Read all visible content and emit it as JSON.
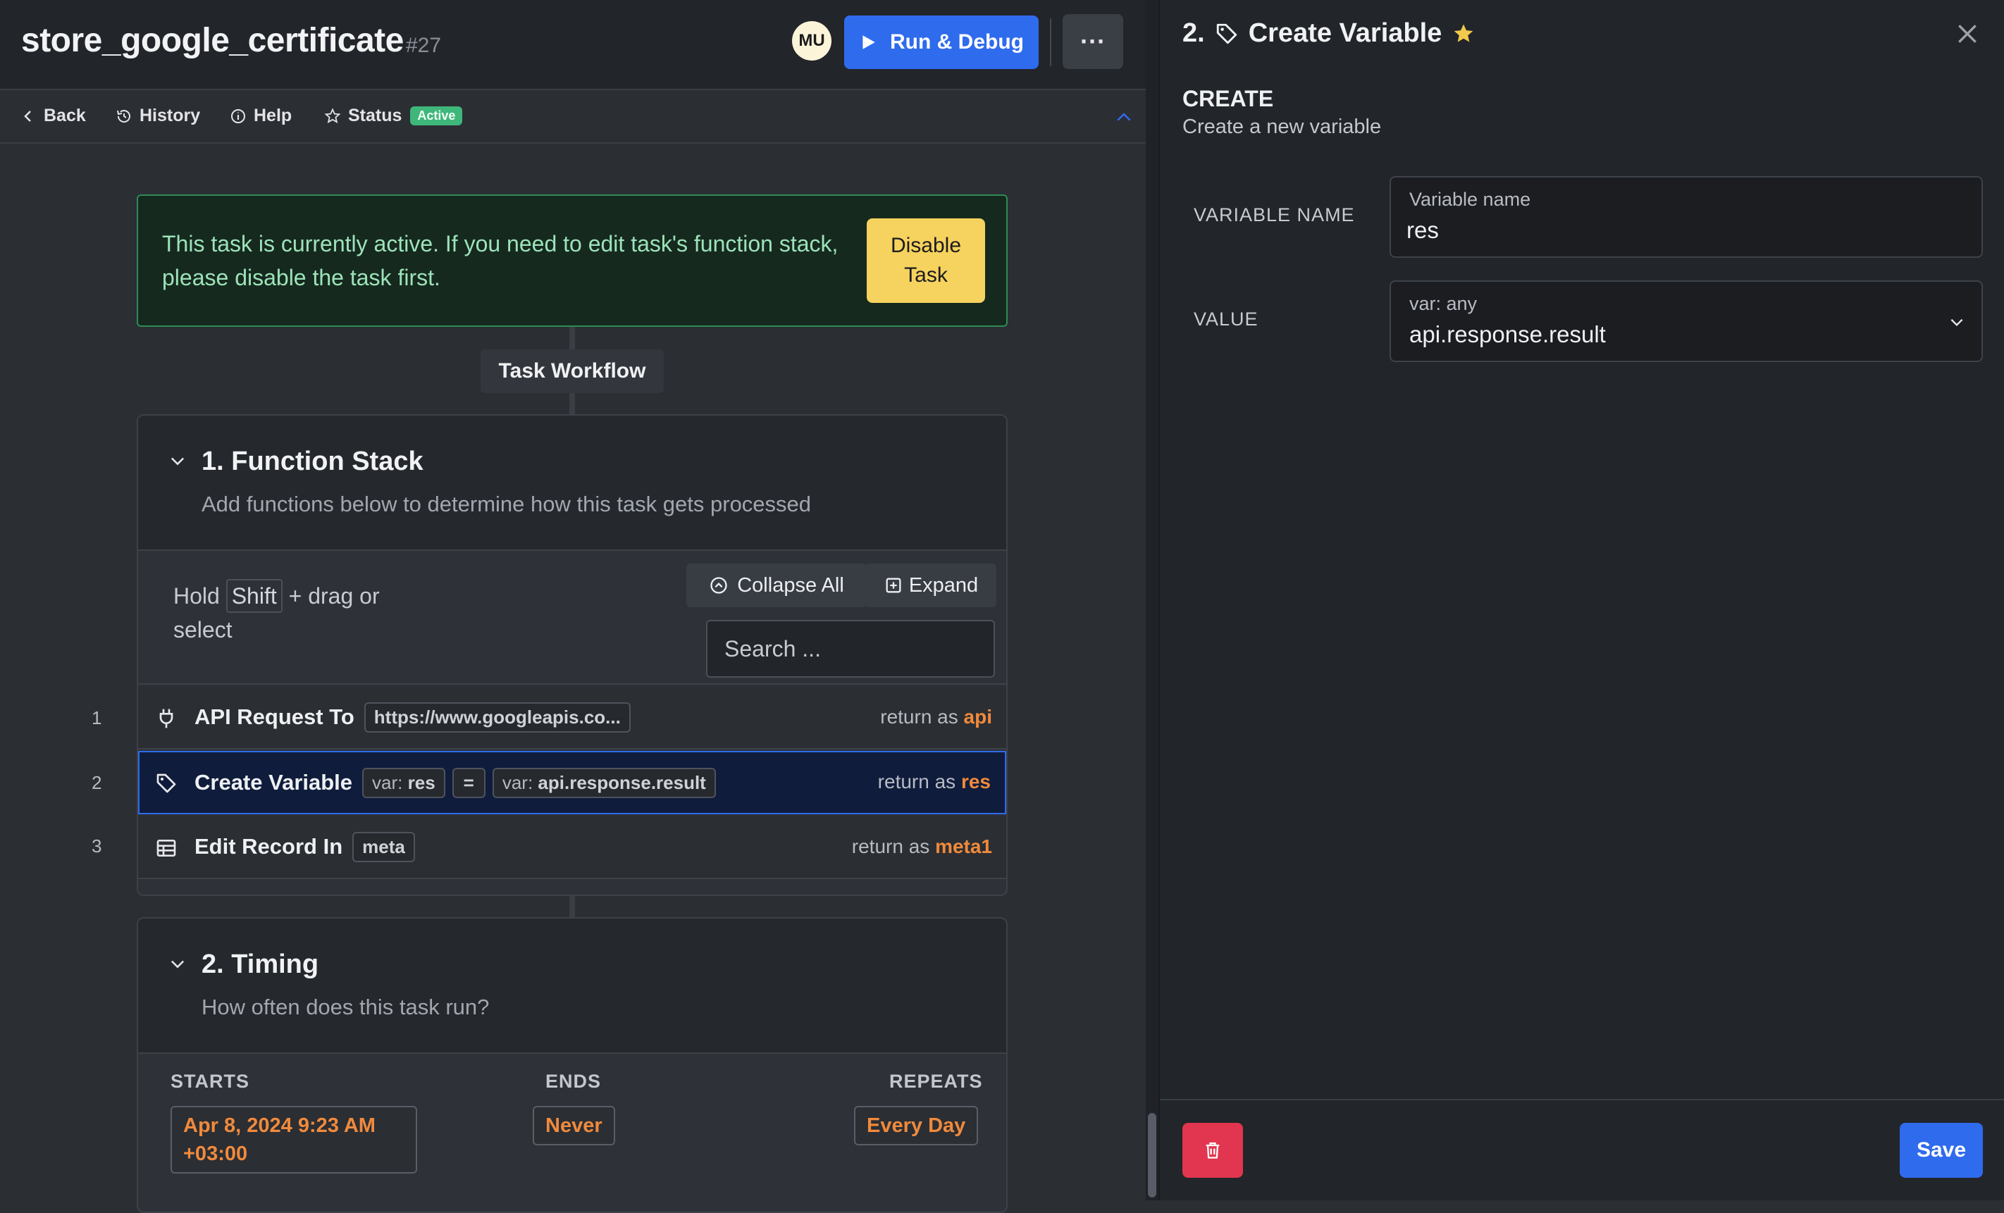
{
  "header": {
    "title": "store_google_certificate",
    "task_id": "#27",
    "avatar_initials": "MU",
    "run_label": "Run & Debug",
    "more_label": "···"
  },
  "nav": {
    "back": "Back",
    "history": "History",
    "help": "Help",
    "status": "Status",
    "status_badge": "Active"
  },
  "alert": {
    "message": "This task is currently active. If you need to edit task's function stack, please disable the task first.",
    "button": "Disable Task"
  },
  "workflow_label": "Task Workflow",
  "function_stack": {
    "title": "1. Function Stack",
    "description": "Add functions below to determine how this task gets processed",
    "hint_prefix": "Hold",
    "hint_key": "Shift",
    "hint_suffix": "+ drag or select",
    "collapse_all": "Collapse All",
    "expand": "Expand",
    "search_placeholder": "Search ...",
    "return_as": "return as",
    "rows": [
      {
        "num": "1",
        "name": "API Request To",
        "chip": "https://www.googleapis.co...",
        "return": "api"
      },
      {
        "num": "2",
        "name": "Create Variable",
        "chip_a_dim": "var:",
        "chip_a": "res",
        "op": "=",
        "chip_b_dim": "var:",
        "chip_b": "api.response.result",
        "return": "res"
      },
      {
        "num": "3",
        "name": "Edit Record In",
        "chip": "meta",
        "return": "meta1"
      }
    ]
  },
  "timing": {
    "title": "2. Timing",
    "description": "How often does this task run?",
    "starts_label": "STARTS",
    "ends_label": "ENDS",
    "repeats_label": "REPEATS",
    "starts_value": "Apr 8, 2024 9:23 AM +03:00",
    "ends_value": "Never",
    "repeats_value": "Every Day"
  },
  "panel": {
    "step": "2.",
    "title": "Create Variable",
    "heading": "CREATE",
    "subheading": "Create a new variable",
    "var_name_label": "VARIABLE NAME",
    "var_name_small": "Variable name",
    "var_name_value": "res",
    "value_label": "VALUE",
    "value_small": "var: any",
    "value_value": "api.response.result",
    "save": "Save"
  },
  "colors": {
    "accent": "#2f6bed",
    "return_var": "#f08a3c",
    "active_badge": "#3fb77a",
    "disable_button": "#f6d25e",
    "delete_button": "#e2354f",
    "star": "#f2c94c"
  },
  "icons": [
    "play-icon",
    "chevron-left-icon",
    "history-icon",
    "info-icon",
    "star-icon",
    "chevron-up-icon",
    "chevron-down-icon",
    "collapse-icon",
    "expand-icon",
    "plug-icon",
    "tag-icon",
    "table-icon",
    "close-icon",
    "trash-icon"
  ]
}
